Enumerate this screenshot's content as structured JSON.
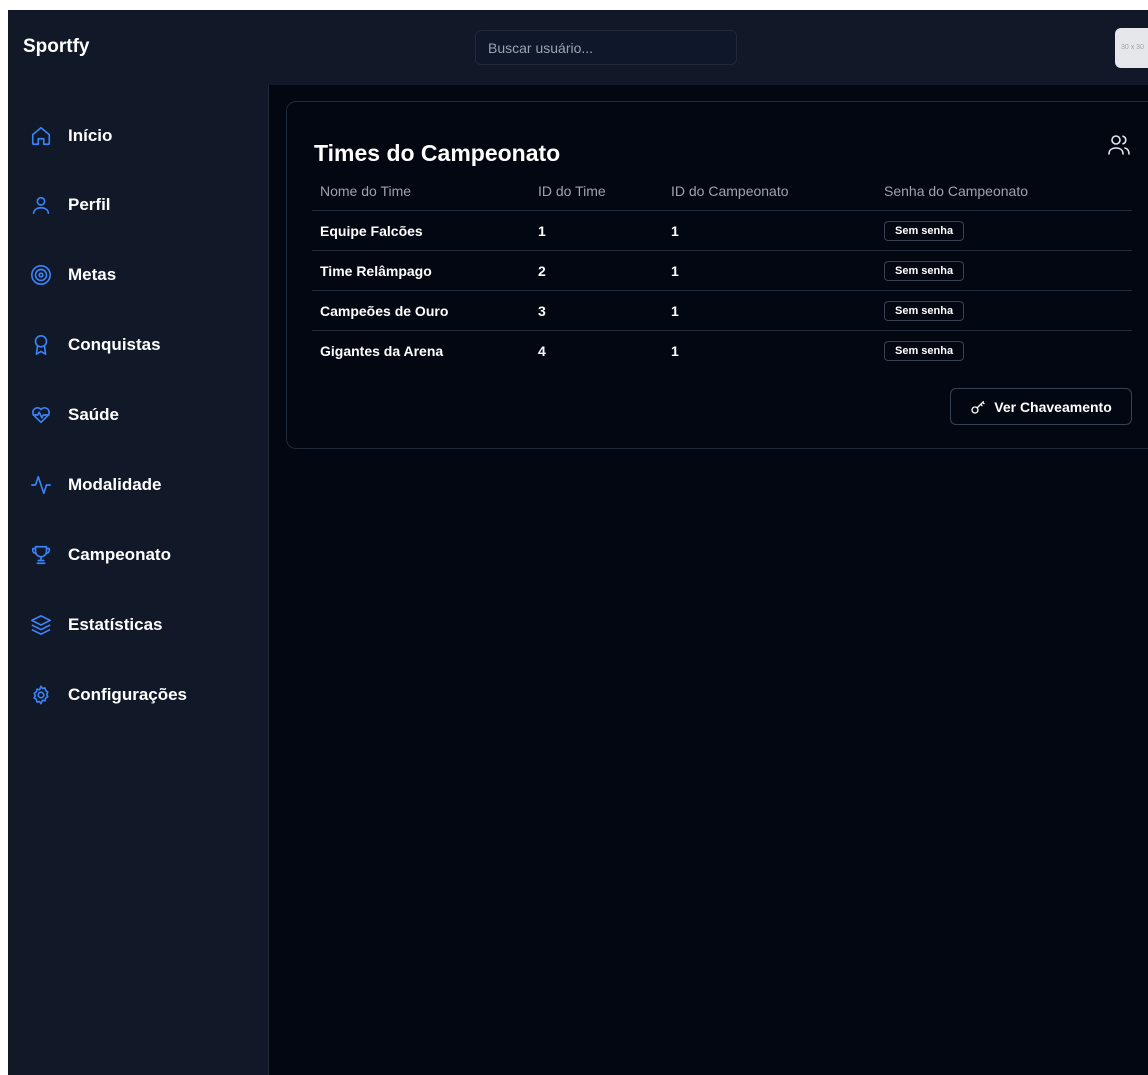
{
  "app": {
    "brand": "Sportfy"
  },
  "search": {
    "placeholder": "Buscar usuário..."
  },
  "avatar": {
    "text": "30 x 30"
  },
  "sidebar": {
    "items": [
      {
        "label": "Início",
        "icon": "home-icon"
      },
      {
        "label": "Perfil",
        "icon": "user-icon"
      },
      {
        "label": "Metas",
        "icon": "target-icon"
      },
      {
        "label": "Conquistas",
        "icon": "award-icon"
      },
      {
        "label": "Saúde",
        "icon": "heart-pulse-icon"
      },
      {
        "label": "Modalidade",
        "icon": "activity-icon"
      },
      {
        "label": "Campeonato",
        "icon": "trophy-icon"
      },
      {
        "label": "Estatísticas",
        "icon": "layers-icon"
      },
      {
        "label": "Configurações",
        "icon": "gear-icon"
      }
    ]
  },
  "card": {
    "title": "Times do Campeonato",
    "table": {
      "headers": [
        "Nome do Time",
        "ID do Time",
        "ID do Campeonato",
        "Senha do Campeonato"
      ],
      "rows": [
        {
          "name": "Equipe Falcões",
          "team_id": "1",
          "championship_id": "1",
          "password": "Sem senha"
        },
        {
          "name": "Time Relâmpago",
          "team_id": "2",
          "championship_id": "1",
          "password": "Sem senha"
        },
        {
          "name": "Campeões de Ouro",
          "team_id": "3",
          "championship_id": "1",
          "password": "Sem senha"
        },
        {
          "name": "Gigantes da Arena",
          "team_id": "4",
          "championship_id": "1",
          "password": "Sem senha"
        }
      ]
    },
    "button_label": "Ver Chaveamento"
  },
  "colors": {
    "accent": "#3b82f6",
    "background": "#030712",
    "panel": "#111827",
    "border": "#1f2937"
  }
}
